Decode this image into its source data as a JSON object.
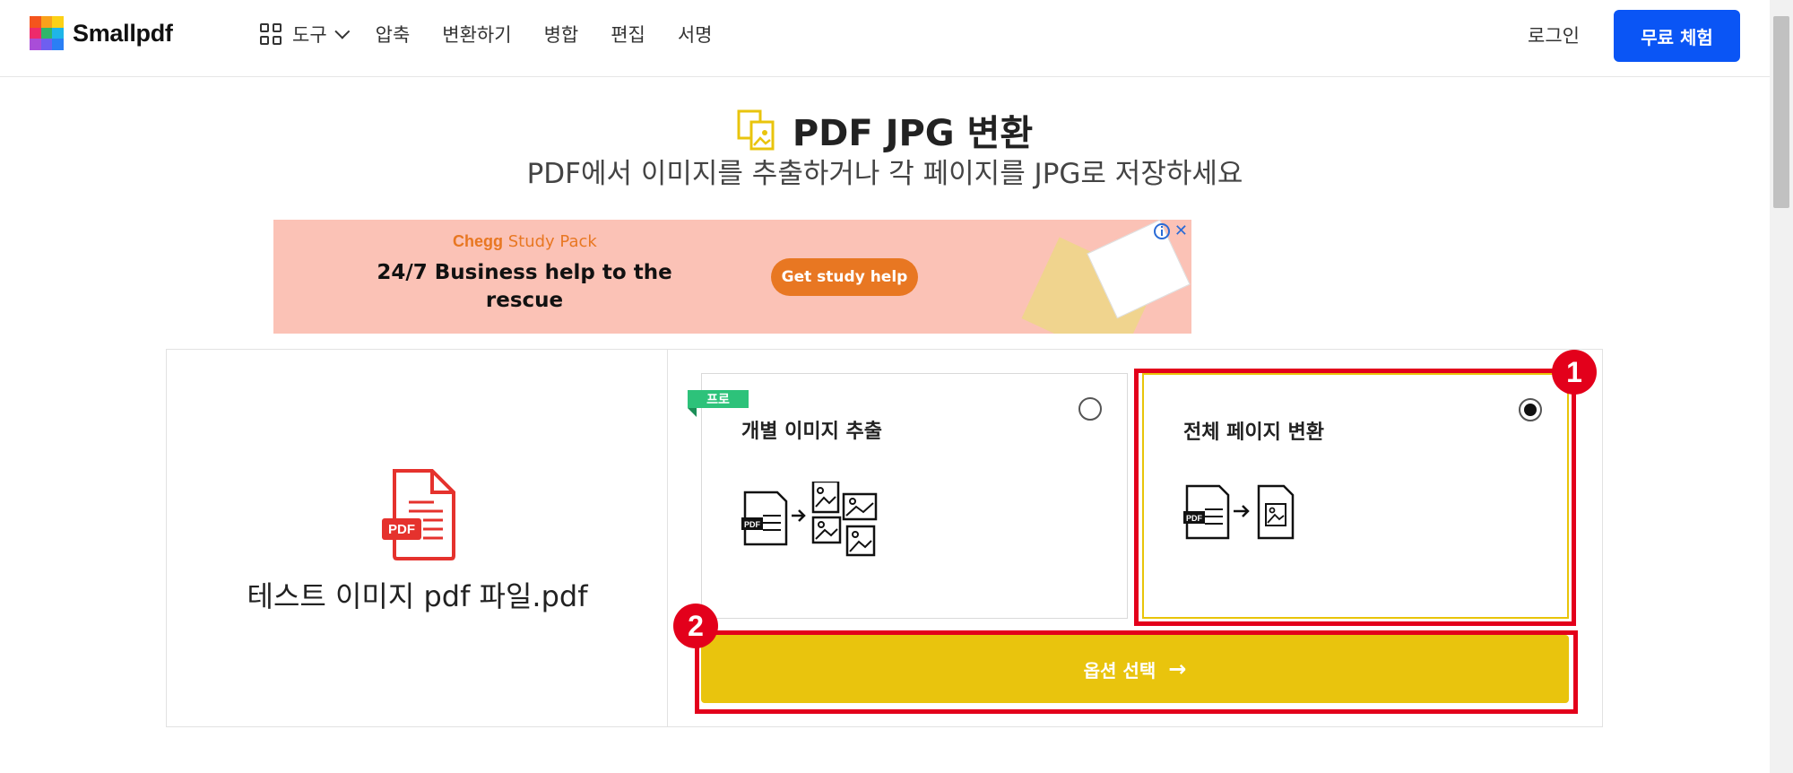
{
  "header": {
    "brand": "Smallpdf",
    "tools_label": "도구",
    "nav": [
      "압축",
      "변환하기",
      "병합",
      "편집",
      "서명"
    ],
    "login": "로그인",
    "cta": "무료 체험"
  },
  "page": {
    "title": "PDF JPG 변환",
    "subtitle": "PDF에서 이미지를 추출하거나 각 페이지를 JPG로 저장하세요"
  },
  "ad": {
    "brand": "Chegg",
    "brand_suffix": "Study Pack",
    "headline": "24/7 Business help to the rescue",
    "button": "Get study help",
    "close": "✕"
  },
  "file": {
    "name": "테스트 이미지 pdf 파일.pdf",
    "badge": "PDF"
  },
  "options": [
    {
      "title": "개별 이미지 추출",
      "pro": "프로",
      "selected": false
    },
    {
      "title": "전체 페이지 변환",
      "selected": true
    }
  ],
  "choose_button": "옵션 선택",
  "annotations": [
    "1",
    "2"
  ],
  "colors": {
    "accent_blue": "#0a55f5",
    "accent_yellow": "#e9c40d",
    "annotation_red": "#e3001b",
    "pro_green": "#2dc27a"
  }
}
